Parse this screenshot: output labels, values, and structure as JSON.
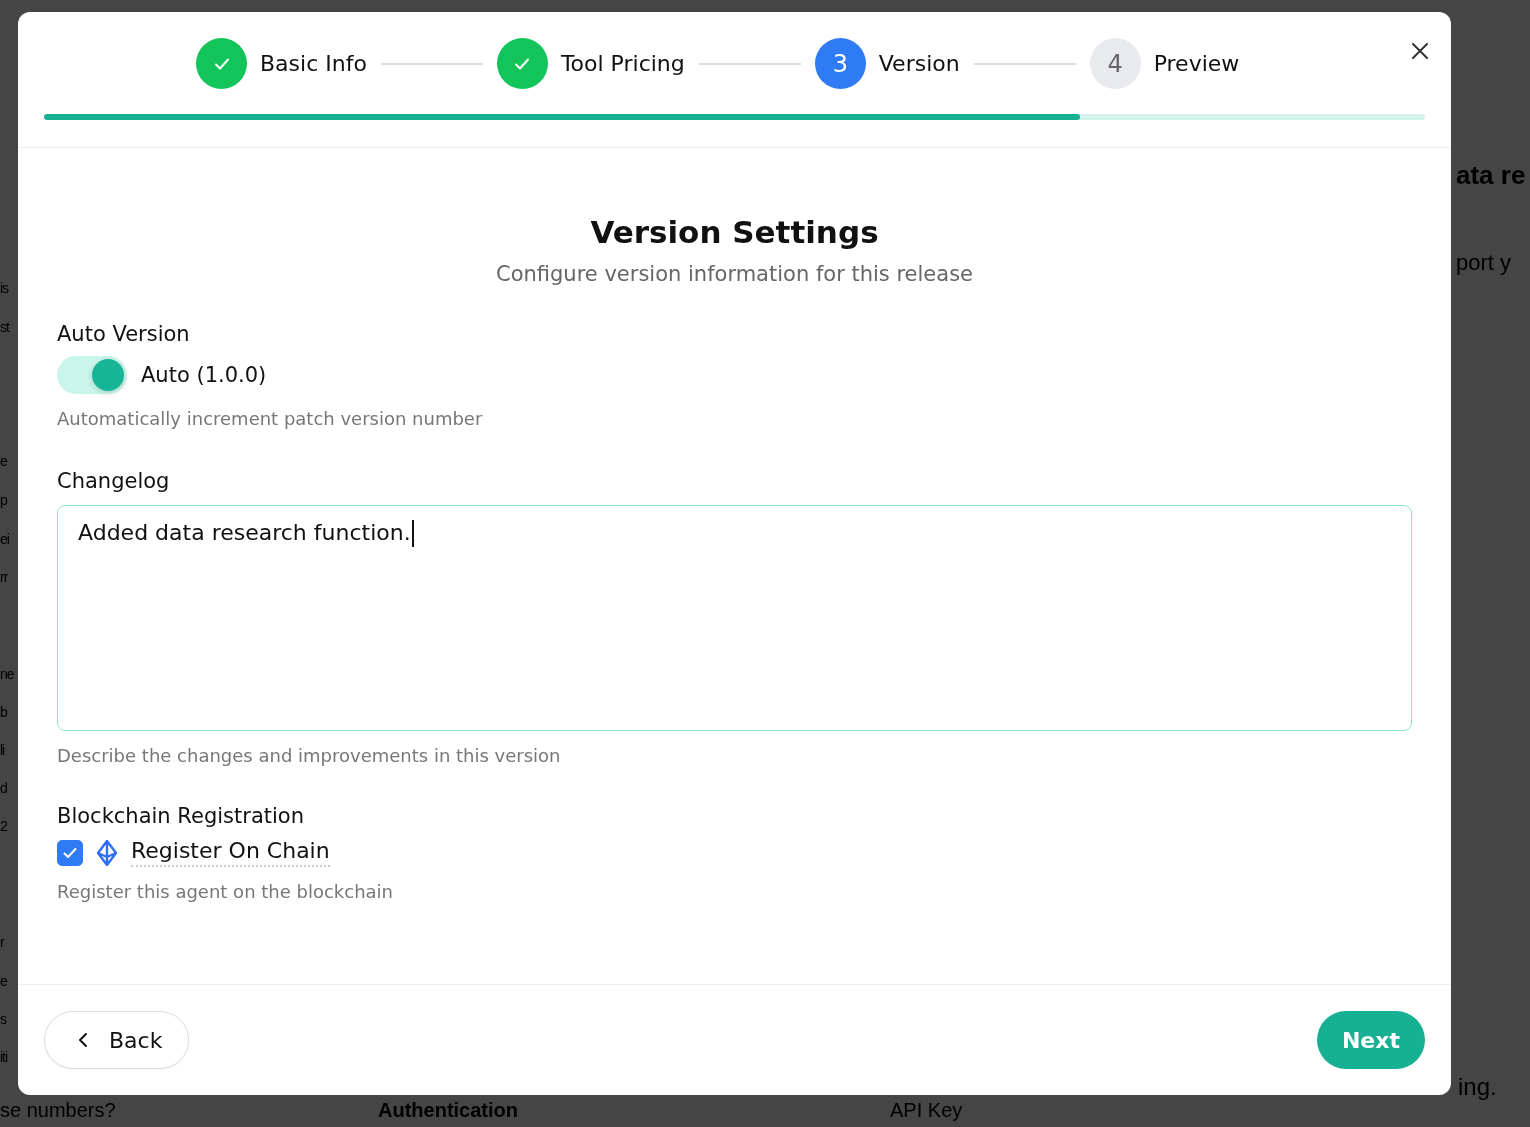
{
  "background": {
    "left_fragments": [
      "is",
      "st",
      "e",
      "p",
      "ei",
      "rr",
      "ne",
      "b",
      "li",
      "d",
      "2",
      "r",
      "e",
      "s",
      "iti"
    ],
    "right_fragments": [
      "ata re",
      "port y"
    ],
    "bottom": {
      "question": "se numbers?",
      "section": "Authentication",
      "select_value": "API Key",
      "note": "ing."
    }
  },
  "stepper": {
    "steps": [
      {
        "label": "Basic Info",
        "completed": true,
        "selected": false
      },
      {
        "label": "Tool Pricing",
        "completed": true,
        "selected": false
      },
      {
        "number": "3",
        "label": "Version",
        "completed": false,
        "selected": true
      },
      {
        "number": "4",
        "label": "Preview",
        "completed": false,
        "selected": false
      }
    ],
    "progress": {
      "level": 0.75
    }
  },
  "title": "Version Settings",
  "subtitle": "Configure version information for this release",
  "auto_version": {
    "label": "Auto Version",
    "toggle_label": "Auto (1.0.0)",
    "on": true,
    "help": "Automatically increment patch version number"
  },
  "changelog": {
    "label": "Changelog",
    "value": "Added data research function.",
    "help": "Describe the changes and improvements in this version"
  },
  "blockchain": {
    "label": "Blockchain Registration",
    "checkbox_label": "Register On Chain",
    "checked": true,
    "help": "Register this agent on the blockchain"
  },
  "footer": {
    "back": "Back",
    "next": "Next"
  }
}
